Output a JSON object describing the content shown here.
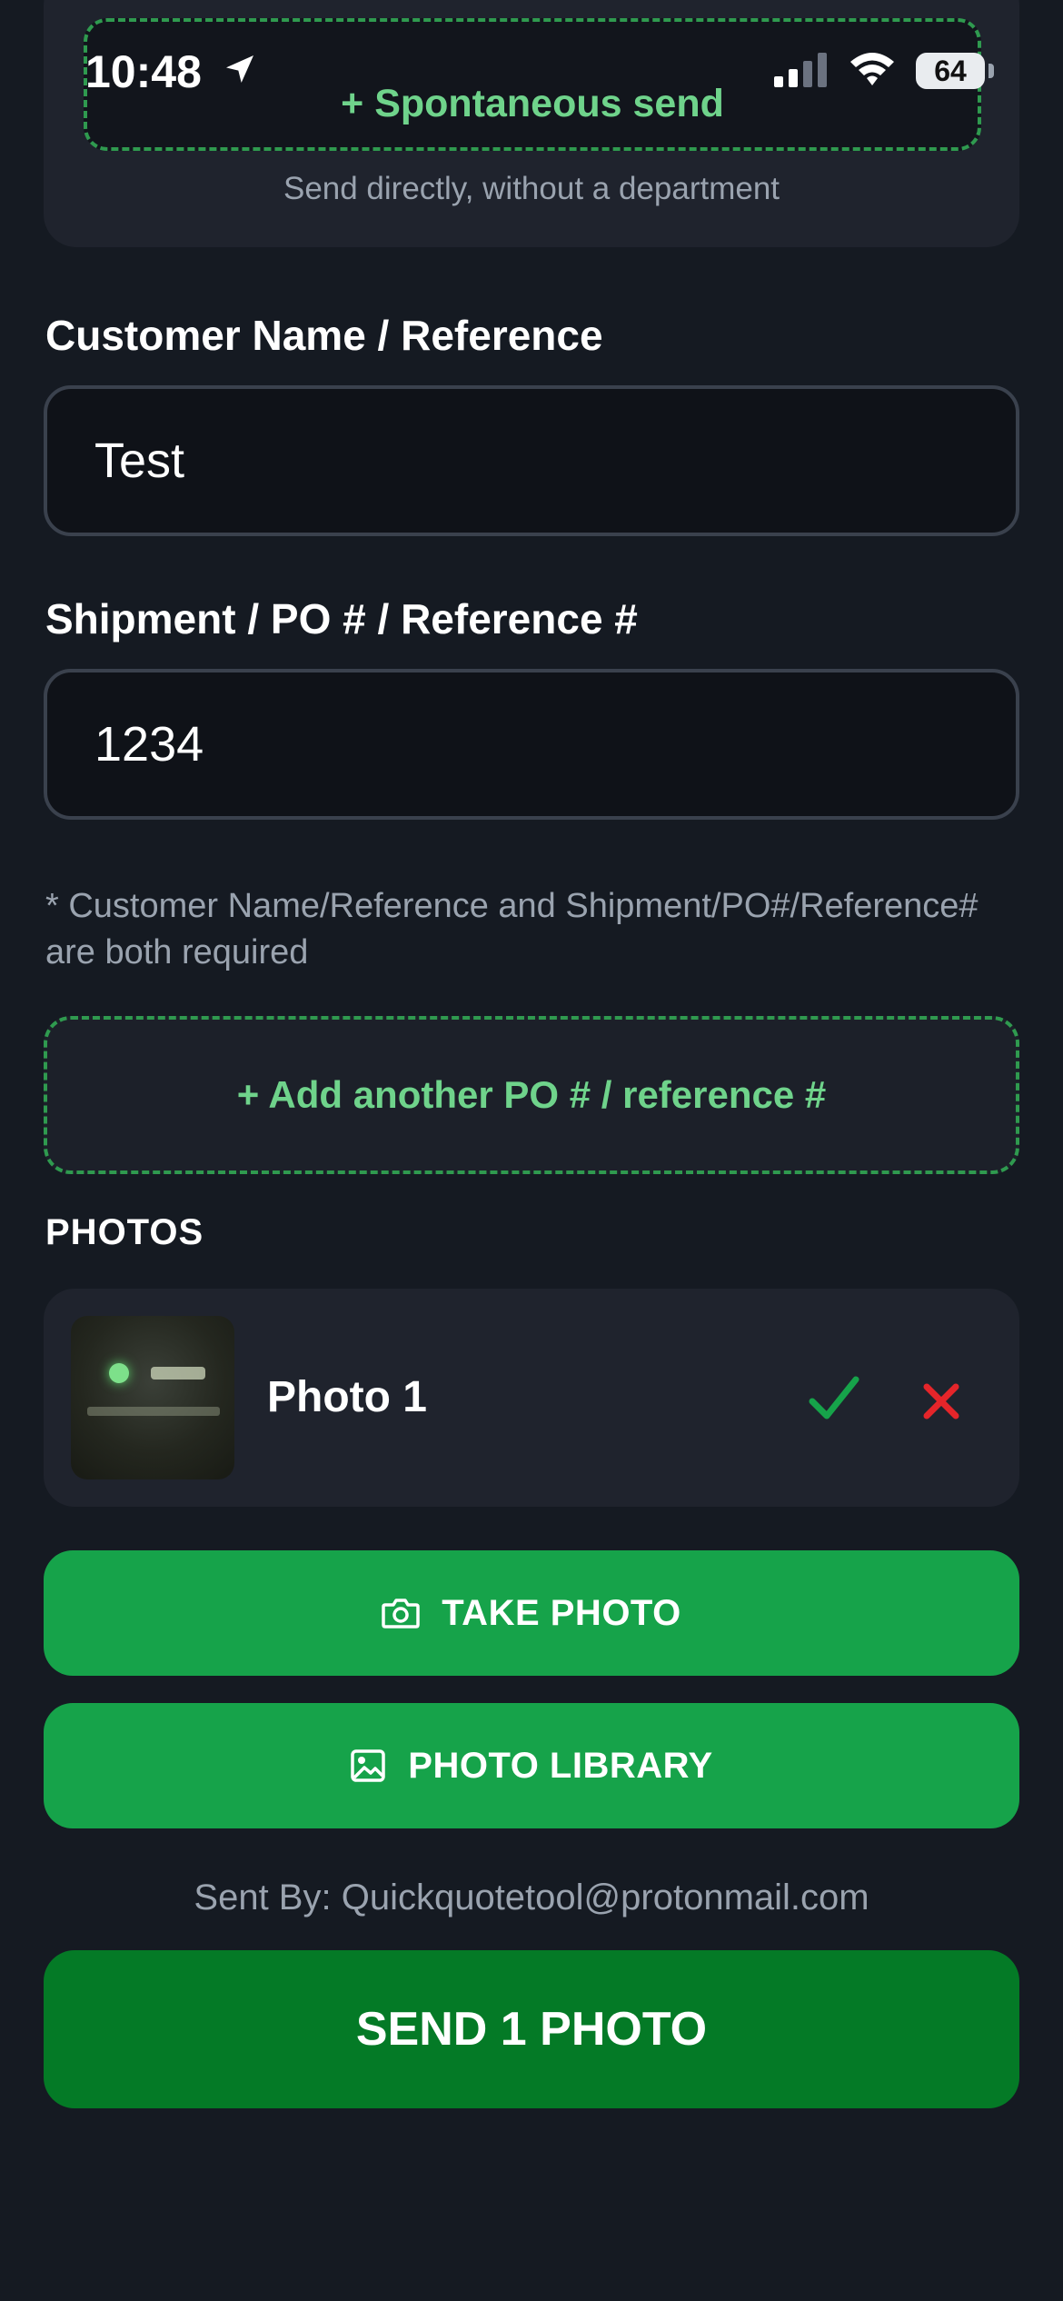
{
  "status_bar": {
    "time": "10:48",
    "battery": "64"
  },
  "spontaneous": {
    "label": "+ Spontaneous send",
    "subtitle": "Send directly, without a department"
  },
  "customer": {
    "label": "Customer Name / Reference",
    "value": "Test"
  },
  "shipment": {
    "label": "Shipment / PO # / Reference #",
    "value": "1234"
  },
  "required_note": "* Customer Name/Reference and Shipment/PO#/Reference# are both required",
  "add_po_label": "+ Add another PO # / reference #",
  "photos": {
    "title": "PHOTOS",
    "items": [
      {
        "name": "Photo 1",
        "status": "confirmed"
      }
    ]
  },
  "buttons": {
    "take_photo": "TAKE PHOTO",
    "photo_library": "PHOTO LIBRARY",
    "send": "SEND 1 PHOTO"
  },
  "sent_by": "Sent By: Quickquotetool@protonmail.com",
  "colors": {
    "background": "#151a22",
    "accent_green": "#16a34a",
    "send_green": "#047a26",
    "dashed_green": "#2f9a4f",
    "text_green": "#6fd38b",
    "delete_red": "#e5252a"
  }
}
